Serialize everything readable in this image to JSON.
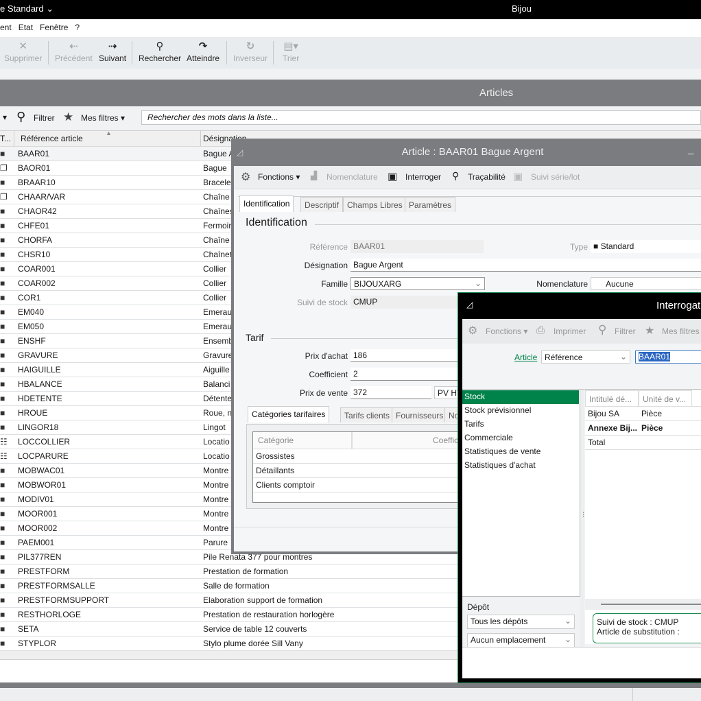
{
  "titlebar": {
    "left": "e Standard",
    "app": "Bijou"
  },
  "menu": [
    "ent",
    "Etat",
    "Fenêtre",
    "?"
  ],
  "toolbar": {
    "supprimer": "Supprimer",
    "precedent": "Précédent",
    "suivant": "Suivant",
    "rechercher": "Rechercher",
    "atteindre": "Atteindre",
    "inverseur": "Inverseur",
    "trier": "Trier"
  },
  "list": {
    "title": "Articles",
    "filter": "Filtrer",
    "my_filters": "Mes filtres",
    "search_placeholder": "Rechercher des mots dans la liste...",
    "col_type": "T...",
    "col_ref": "Référence article",
    "col_des": "Désignation",
    "rows": [
      [
        "box",
        "BAAR01",
        "Bague A"
      ],
      [
        "multi",
        "BAOR01",
        "Bague"
      ],
      [
        "box",
        "BRAAR10",
        "Bracelet"
      ],
      [
        "multi",
        "CHAAR/VAR",
        "Chaîne"
      ],
      [
        "box",
        "CHAOR42",
        "Chaînes"
      ],
      [
        "box",
        "CHFE01",
        "Fermoir"
      ],
      [
        "box",
        "CHORFA",
        "Chaîne"
      ],
      [
        "box",
        "CHSR10",
        "Chaînet"
      ],
      [
        "box",
        "COAR001",
        "Collier"
      ],
      [
        "box",
        "COAR002",
        "Collier"
      ],
      [
        "box",
        "COR1",
        "Collier"
      ],
      [
        "box",
        "EM040",
        "Emerau"
      ],
      [
        "box",
        "EM050",
        "Emerau"
      ],
      [
        "box",
        "ENSHF",
        "Ensemb"
      ],
      [
        "box",
        "GRAVURE",
        "Gravure"
      ],
      [
        "box",
        "HAIGUILLE",
        "Aiguille"
      ],
      [
        "box",
        "HBALANCE",
        "Balanci"
      ],
      [
        "box",
        "HDETENTE",
        "Détente"
      ],
      [
        "box",
        "HROUE",
        "Roue, n"
      ],
      [
        "box",
        "LINGOR18",
        "Lingot"
      ],
      [
        "service",
        "LOCCOLLIER",
        "Locatio"
      ],
      [
        "service",
        "LOCPARURE",
        "Locatio"
      ],
      [
        "box",
        "MOBWAC01",
        "Montre"
      ],
      [
        "box",
        "MOBWOR01",
        "Montre"
      ],
      [
        "box",
        "MODIV01",
        "Montre"
      ],
      [
        "box",
        "MOOR001",
        "Montre"
      ],
      [
        "box",
        "MOOR002",
        "Montre"
      ],
      [
        "box",
        "PAEM001",
        "Parure"
      ],
      [
        "box",
        "PIL377REN",
        "Pile Renata 377 pour montres"
      ],
      [
        "box",
        "PRESTFORM",
        "Prestation de formation"
      ],
      [
        "box",
        "PRESTFORMSALLE",
        "Salle de formation"
      ],
      [
        "box",
        "PRESTFORMSUPPORT",
        "Elaboration support de formation"
      ],
      [
        "box",
        "RESTHORLOGE",
        "Prestation de restauration horlogère"
      ],
      [
        "box",
        "SETA",
        "Service de table 12 couverts"
      ],
      [
        "box",
        "STYPLOR",
        "Stylo plume dorée Sill Vany"
      ]
    ]
  },
  "article": {
    "title": "Article : BAAR01 Bague Argent",
    "fonctions": "Fonctions",
    "nomenclature": "Nomenclature",
    "interroger": "Interroger",
    "tracabilite": "Traçabilité",
    "suivi": "Suivi série/lot",
    "tabs": [
      "Identification",
      "Descriptif",
      "Champs Libres",
      "Paramètres"
    ],
    "section_ident": "Identification",
    "ref_label": "Référence",
    "ref": "BAAR01",
    "type_label": "Type",
    "type": "Standard",
    "des_label": "Désignation",
    "des": "Bague Argent",
    "fam_label": "Famille",
    "fam": "BIJOUXARG",
    "nom_label": "Nomenclature",
    "nom": "Aucune",
    "suivi_label": "Suivi de stock",
    "suivi_val": "CMUP",
    "section_tarif": "Tarif",
    "pa_label": "Prix d'achat",
    "pa": "186",
    "coef_label": "Coefficient",
    "coef": "2",
    "pv_label": "Prix de vente",
    "pv": "372",
    "pv_type": "PV HT",
    "subtabs": [
      "Catégories tarifaires",
      "Tarifs clients",
      "Fournisseurs",
      "Nouve"
    ],
    "cat_col": "Catégorie",
    "coef_col": "Coeffic",
    "cats": [
      "Grossistes",
      "Détaillants",
      "Clients comptoir"
    ]
  },
  "interro": {
    "title": "Interrogat",
    "fonctions": "Fonctions",
    "imprimer": "Imprimer",
    "filtrer": "Filtrer",
    "mes_filtres": "Mes filtres",
    "article_link": "Article",
    "criteria": "Référence",
    "value": "BAAR01",
    "menu": [
      "Stock",
      "Stock prévisionnel",
      "Tarifs",
      "Commerciale",
      "Statistiques de vente",
      "Statistiques d'achat"
    ],
    "cols": [
      "Intitulé dé...",
      "Unité de v..."
    ],
    "rows": [
      [
        "Bijou SA",
        "Pièce"
      ],
      [
        "Annexe Bij...",
        "Pièce"
      ],
      [
        "Total",
        ""
      ]
    ],
    "depot_label": "Dépôt",
    "depot": "Tous les dépôts",
    "emplacement": "Aucun emplacement",
    "info1": "Suivi de stock : CMUP",
    "info2": "Article de substitution :"
  },
  "colors": {
    "accent": "#00834a",
    "header": "#7b7c80"
  }
}
